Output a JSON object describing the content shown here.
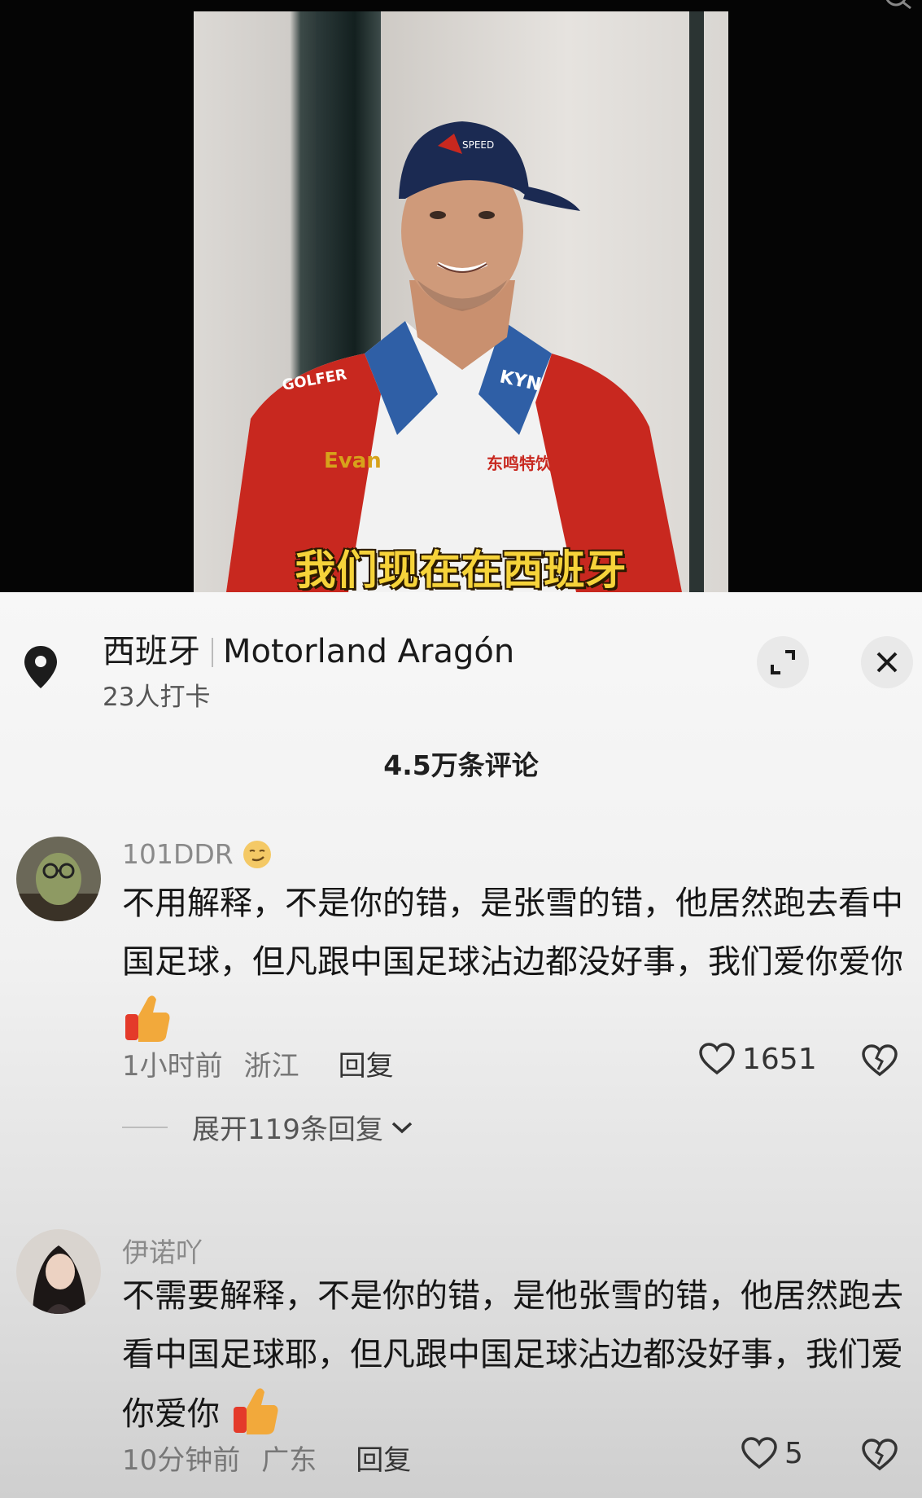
{
  "video": {
    "subtitle": "我们现在在西班牙"
  },
  "location": {
    "name": "西班牙",
    "venue": "Motorland Aragón",
    "checkins": "23人打卡"
  },
  "comments_header": {
    "count_label": "4.5万条评论"
  },
  "comments": [
    {
      "username": "101DDR",
      "text": "不用解释，不是你的错，是张雪的错，他居然跑去看中国足球，但凡跟中国足球沾边都没好事，我们爱你爱你",
      "time": "1小时前",
      "region": "浙江",
      "reply_label": "回复",
      "likes": "1651",
      "expand_label": "展开119条回复"
    },
    {
      "username": "伊诺吖",
      "text": "不需要解释，不是你的错，是他张雪的错，他居然跑去看中国足球耶，但凡跟中国足球沾边都没好事，我们爱你爱你",
      "time": "10分钟前",
      "region": "广东",
      "reply_label": "回复",
      "likes": "5"
    }
  ],
  "icons": {
    "location": "map-pin-icon",
    "expand": "expand-icon",
    "close": "close-icon",
    "like": "heart-icon",
    "dislike": "broken-heart-icon",
    "chevron": "chevron-down-icon",
    "thumb": "thumbs-up-emoji",
    "smirk": "smirk-emoji"
  }
}
